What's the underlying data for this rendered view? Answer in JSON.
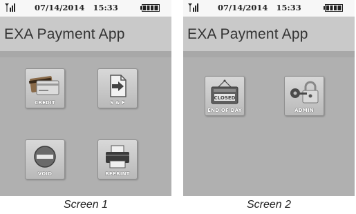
{
  "screens": [
    {
      "status": {
        "date": "07/14/2014",
        "time": "15:33"
      },
      "title": "EXA Payment App",
      "tiles": [
        {
          "label": "CREDIT",
          "icon": "credit-card-icon"
        },
        {
          "label": "S & F",
          "icon": "store-forward-icon"
        },
        {
          "label": "VOID",
          "icon": "void-icon"
        },
        {
          "label": "REPRINT",
          "icon": "printer-icon"
        }
      ],
      "caption": "Screen 1"
    },
    {
      "status": {
        "date": "07/14/2014",
        "time": "15:33"
      },
      "title": "EXA Payment App",
      "tiles": [
        {
          "label": "END OF DAY",
          "icon": "closed-sign-icon"
        },
        {
          "label": "ADMIN",
          "icon": "lock-key-icon"
        }
      ],
      "caption": "Screen 2"
    }
  ],
  "colors": {
    "screen_bg": "#b0b0b0",
    "header_bg": "#c9c9c9",
    "status_bg": "#f7f7f7"
  }
}
